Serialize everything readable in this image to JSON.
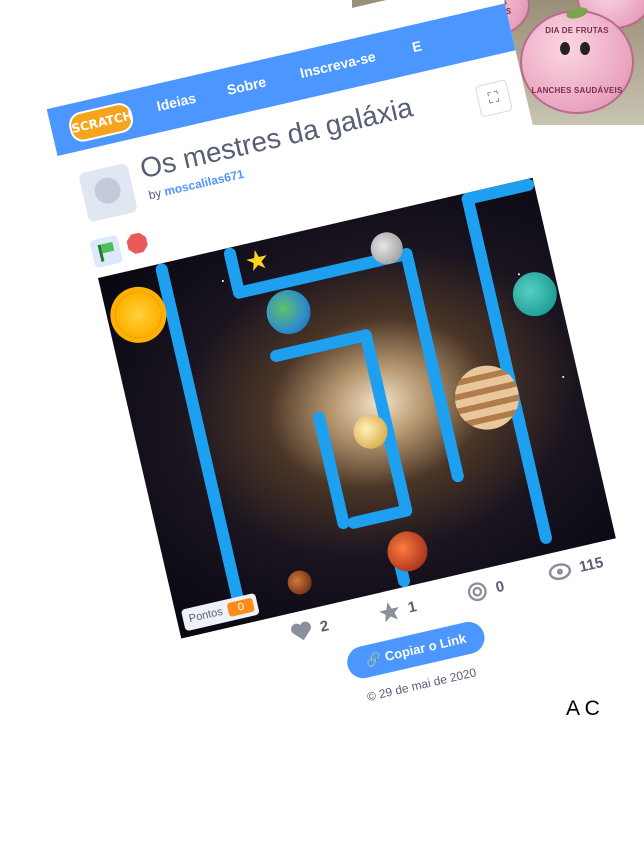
{
  "photo": {
    "apple_top_left_caption": "LANCHES SAUDÁVEIS",
    "apple_main_top": "DIA DE FRUTAS",
    "apple_main_caption": "LANCHES SAUDÁVEIS"
  },
  "nav": {
    "logo": "SCRATCH",
    "items": [
      "Ideias",
      "Sobre",
      "Inscreva-se",
      "E"
    ]
  },
  "project": {
    "title": "Os mestres da galáxia",
    "by_prefix": "by",
    "author": "moscalilas671"
  },
  "stage": {
    "score_label": "Pontos",
    "score_value": "0"
  },
  "stats": {
    "loves": "2",
    "favorites": "1",
    "remixes": "0",
    "views": "115"
  },
  "actions": {
    "copy_link": "Copiar o Link"
  },
  "meta": {
    "date": "29 de mai de 2020"
  },
  "side": {
    "text": "A C"
  },
  "colors": {
    "brand": "#4c97ff",
    "maze_wall": "#1ea0f0",
    "score_badge": "#ff8c1a"
  },
  "icons": [
    "flag-icon",
    "stop-icon",
    "fullscreen-icon",
    "heart-icon",
    "star-icon",
    "remix-icon",
    "eye-icon",
    "link-icon",
    "copyright-icon"
  ]
}
